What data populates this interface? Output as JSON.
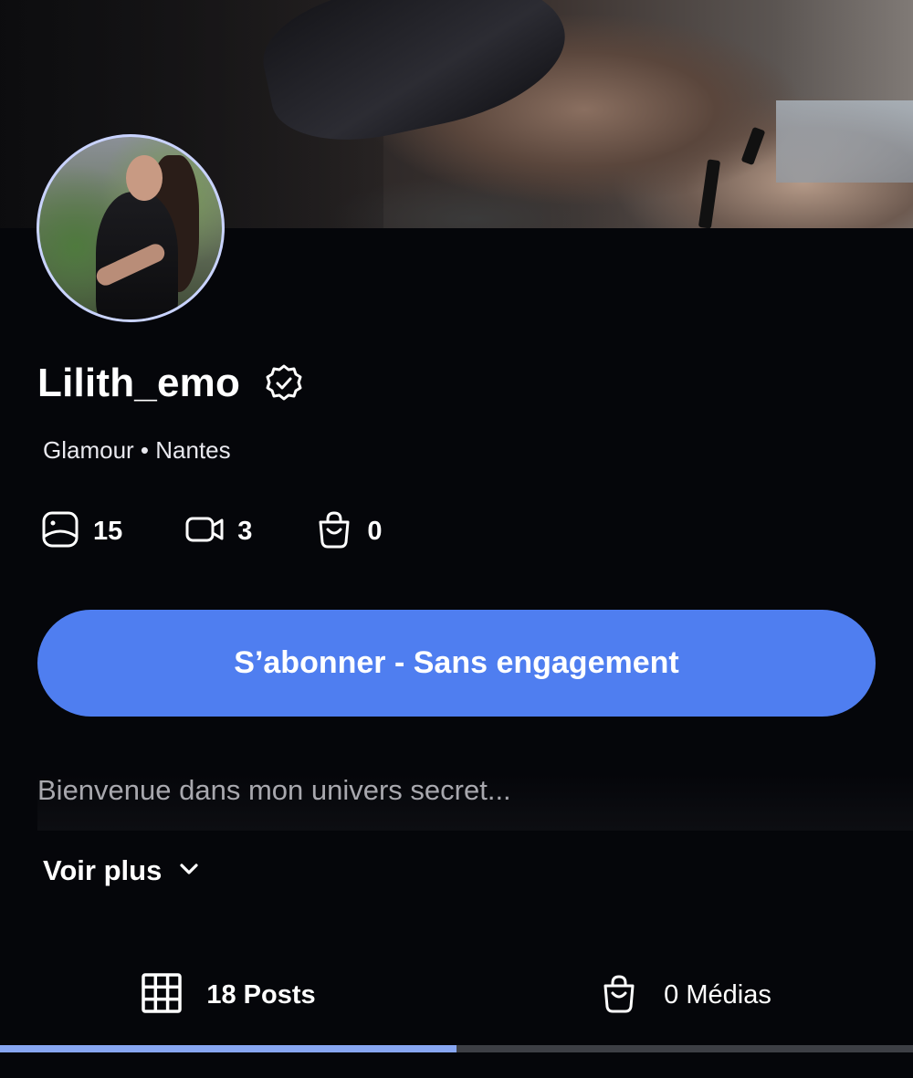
{
  "profile": {
    "username": "Lilith_emo",
    "subtitle": "Glamour • Nantes",
    "bio": "Bienvenue dans mon univers secret...",
    "see_more": "Voir plus"
  },
  "stats": [
    {
      "icon": "photo-icon",
      "value": "15"
    },
    {
      "icon": "video-icon",
      "value": "3"
    },
    {
      "icon": "shopping-bag-icon",
      "value": "0"
    }
  ],
  "subscribe": {
    "label": "S’abonner - Sans engagement"
  },
  "tabs": [
    {
      "icon": "grid-icon",
      "label": "18 Posts",
      "active": true
    },
    {
      "icon": "shopping-bag-icon",
      "label": "0 Médias",
      "active": false
    }
  ],
  "colors": {
    "background": "#05060a",
    "accent": "#4f7ef0",
    "tab_indicator": "#87a6f2",
    "verified_badge": "#ffffff"
  }
}
